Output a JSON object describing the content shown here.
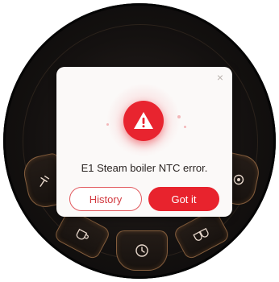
{
  "dialog": {
    "message": "E1 Steam boiler NTC error.",
    "close_label": "×",
    "history_label": "History",
    "gotit_label": "Got it"
  },
  "icons": {
    "alert": "warning-icon",
    "close": "close-icon",
    "left": "grinder-icon",
    "right": "settings-icon",
    "bottom_left": "cup-icon",
    "bottom": "timer-icon",
    "bottom_right": "double-cup-icon"
  },
  "colors": {
    "accent_red": "#e8232d",
    "tile_border": "#d6965f",
    "background": "#141110"
  }
}
